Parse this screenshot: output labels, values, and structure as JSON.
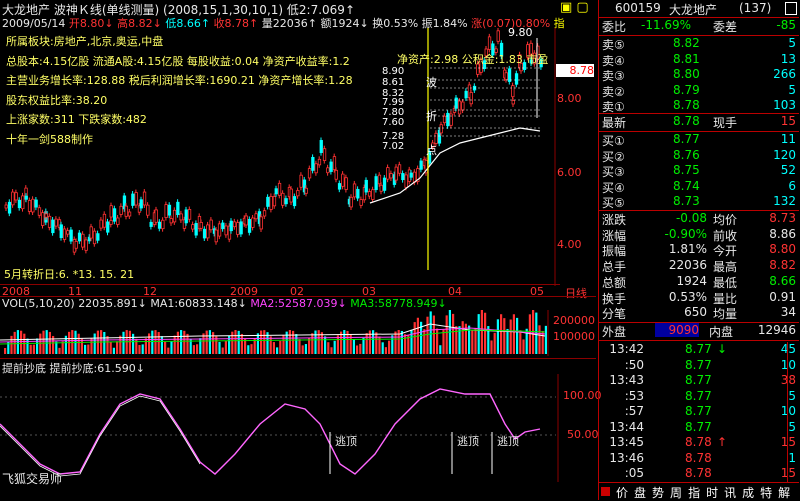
{
  "header": {
    "title": "大龙地产 波神Ｋ线(单线测量)",
    "params": "(2008,15,1,30,10,1)",
    "low": "低2:7.069↑",
    "date": "2009/05/14",
    "open": "开8.80↓",
    "high": "高8.82↓",
    "lo": "低8.66↑",
    "close": "收8.78↑",
    "vol": "量22036↑",
    "amount": "额1924↓",
    "turnover": "换0.53%",
    "amp": "振1.84%",
    "chg": "涨(0.07)0.80%",
    "idx": "指",
    "close_icons": "▣ ▢"
  },
  "info_lines": [
    "所属板块:房地产,北京,奥运,中盘",
    "总股本:4.15亿股 流通A股:4.15亿股 每股收益:0.04 净资产收益率:1.2",
    "主营业务增长率:128.88 税后利润增长率:1690.21 净资产增长率:1.28",
    "股东权益比率:38.20",
    "上涨家数:311  下跌家数:482",
    "十年一剑588制作"
  ],
  "info_extra": "净资产:2.98 公积金:1.83 市盈",
  "fib_labels": [
    "8.90",
    "8.61",
    "8.32",
    "7.99",
    "7.80",
    "7.60",
    "7.28",
    "7.02"
  ],
  "peak_label": "9.80",
  "price_tag": "8.78",
  "pivot_labels": [
    "波",
    "折",
    "点"
  ],
  "y_ticks": [
    "8.00",
    "6.00",
    "4.00"
  ],
  "bottom_note": "5月转折日:6. *13. 15. 21",
  "x_axis": [
    "2008",
    "11",
    "12",
    "2009",
    "02",
    "03",
    "04",
    "05",
    "日线"
  ],
  "vol_header": {
    "label": "VOL(5,10,20)",
    "v": "22035.891↓",
    "ma1": "MA1:60833.148↓",
    "ma2": "MA2:52587.039↓",
    "ma3": "MA3:58778.949↓"
  },
  "vol_ticks": [
    "200000",
    "100000"
  ],
  "ind_header": {
    "name": "提前抄底",
    "value": "提前抄底:61.590↓"
  },
  "ind_ticks": [
    "100.00",
    "50.00"
  ],
  "escape_labels": [
    "逃顶",
    "逃顶",
    "逃顶"
  ],
  "watermark": "飞狐交易师",
  "right": {
    "code": "600159",
    "name": "大龙地产",
    "count": "(137)",
    "weibi_label": "委比",
    "weibi_val": "-11.69%",
    "weicha_label": "委差",
    "weicha_val": "-85",
    "asks": [
      {
        "label": "卖⑤",
        "price": "8.82",
        "vol": "5"
      },
      {
        "label": "卖④",
        "price": "8.81",
        "vol": "13"
      },
      {
        "label": "卖③",
        "price": "8.80",
        "vol": "266"
      },
      {
        "label": "卖②",
        "price": "8.79",
        "vol": "5"
      },
      {
        "label": "卖①",
        "price": "8.78",
        "vol": "103"
      }
    ],
    "latest_label": "最新",
    "latest_val": "8.78",
    "xianshou_label": "现手",
    "xianshou_val": "15",
    "bids": [
      {
        "label": "买①",
        "price": "8.77",
        "vol": "11"
      },
      {
        "label": "买②",
        "price": "8.76",
        "vol": "120"
      },
      {
        "label": "买③",
        "price": "8.75",
        "vol": "52"
      },
      {
        "label": "买④",
        "price": "8.74",
        "vol": "6"
      },
      {
        "label": "买⑤",
        "price": "8.73",
        "vol": "132"
      }
    ],
    "stats": [
      {
        "l1": "涨跌",
        "v1": "-0.08",
        "l2": "均价",
        "v2": "8.73"
      },
      {
        "l1": "涨幅",
        "v1": "-0.90%",
        "l2": "前收",
        "v2": "8.86"
      },
      {
        "l1": "振幅",
        "v1": "1.81%",
        "l2": "今开",
        "v2": "8.80"
      },
      {
        "l1": "总手",
        "v1": "22036",
        "l2": "最高",
        "v2": "8.82"
      },
      {
        "l1": "总额",
        "v1": "1924",
        "l2": "最低",
        "v2": "8.66"
      },
      {
        "l1": "换手",
        "v1": "0.53%",
        "l2": "量比",
        "v2": "0.91"
      },
      {
        "l1": "分笔",
        "v1": "650",
        "l2": "均量",
        "v2": "34"
      }
    ],
    "outer_label": "外盘",
    "outer_val": "9090",
    "inner_label": "内盘",
    "inner_val": "12946",
    "ticks": [
      {
        "time": "13:42",
        "price": "8.77",
        "arrow": "↓",
        "vol": "45"
      },
      {
        "time": ":50",
        "price": "8.77",
        "arrow": "",
        "vol": "10"
      },
      {
        "time": "13:43",
        "price": "8.77",
        "arrow": "",
        "vol": "38"
      },
      {
        "time": ":53",
        "price": "8.77",
        "arrow": "",
        "vol": "5"
      },
      {
        "time": ":57",
        "price": "8.77",
        "arrow": "",
        "vol": "10"
      },
      {
        "time": "13:44",
        "price": "8.77",
        "arrow": "",
        "vol": "5"
      },
      {
        "time": "13:45",
        "price": "8.78",
        "arrow": "↑",
        "vol": "15"
      },
      {
        "time": "13:46",
        "price": "8.78",
        "arrow": "",
        "vol": "1"
      },
      {
        "time": ":05",
        "price": "8.78",
        "arrow": "",
        "vol": "15"
      }
    ],
    "toolbar": [
      "价",
      "盘",
      "势",
      "周",
      "指",
      "时",
      "讯",
      "成",
      "特",
      "解"
    ]
  }
}
